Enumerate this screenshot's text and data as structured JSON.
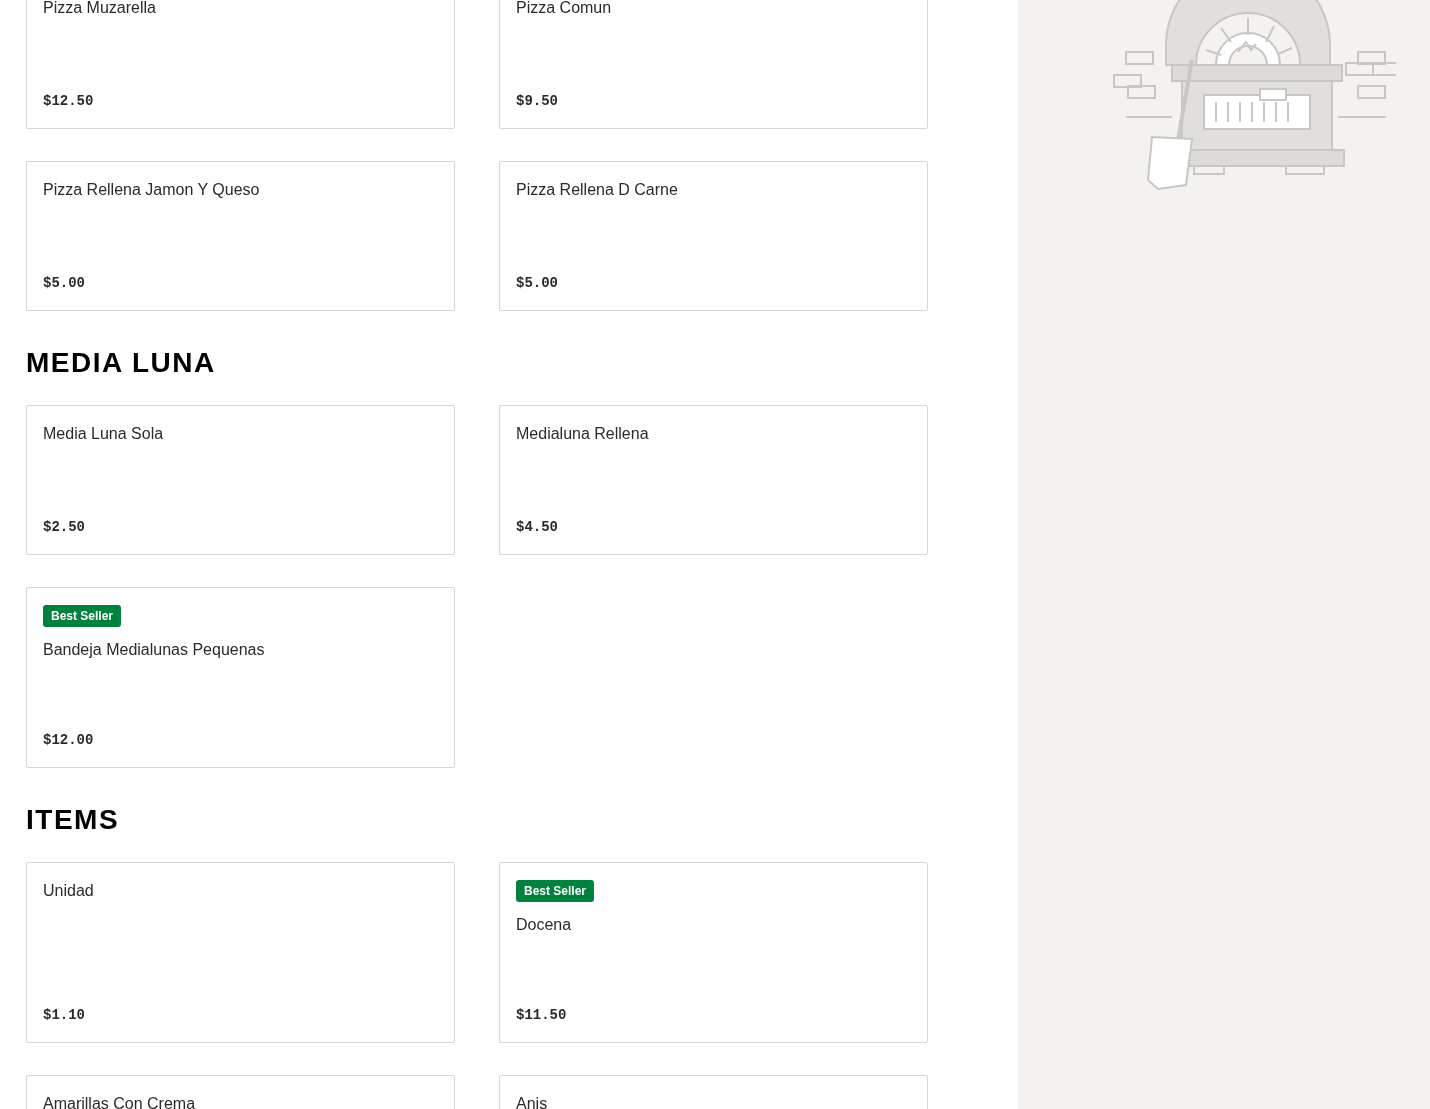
{
  "sections": [
    {
      "items": [
        {
          "name": "Pizza Muzarella",
          "price": "$12.50"
        },
        {
          "name": "Pizza Comun",
          "price": "$9.50"
        },
        {
          "name": "Pizza Rellena Jamon Y Queso",
          "price": "$5.00"
        },
        {
          "name": "Pizza Rellena D Carne",
          "price": "$5.00"
        }
      ]
    },
    {
      "heading": "MEDIA LUNA",
      "items": [
        {
          "name": "Media Luna Sola",
          "price": "$2.50"
        },
        {
          "name": "Medialuna Rellena",
          "price": "$4.50"
        },
        {
          "badge": "Best Seller",
          "name": "Bandeja Medialunas Pequenas",
          "price": "$12.00"
        }
      ]
    },
    {
      "heading": "ITEMS",
      "items": [
        {
          "name": "Unidad",
          "price": "$1.10"
        },
        {
          "badge": "Best Seller",
          "name": "Docena",
          "price": "$11.50"
        },
        {
          "name": "Amarillas Con Crema"
        },
        {
          "name": "Anis"
        }
      ]
    }
  ]
}
